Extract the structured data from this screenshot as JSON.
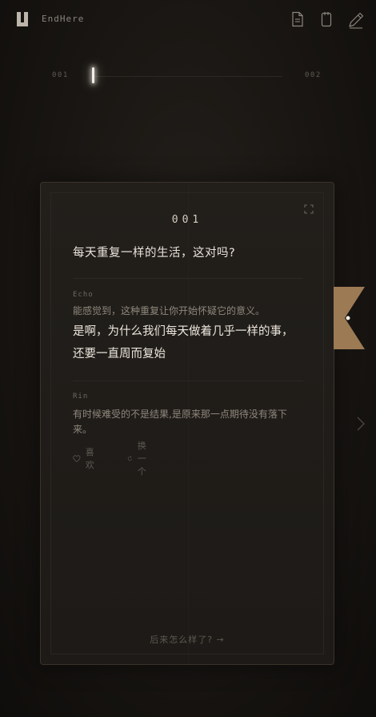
{
  "header": {
    "app_title": "EndHere",
    "icons": [
      "logo-icon",
      "document-icon",
      "phone-icon",
      "pen-icon"
    ]
  },
  "progress": {
    "start_label": "001",
    "end_label": "002",
    "position": 0.0
  },
  "card": {
    "number": "001",
    "question": "每天重复一样的生活，这对吗?",
    "replies": [
      {
        "author": "Echo",
        "text": "能感觉到，这种重复让你开始怀疑它的意义。",
        "highlight_lines": [
          "是啊，为什么我们每天做着几乎一样的事，",
          "还要一直周而复始"
        ]
      },
      {
        "author": "Rin",
        "text_lines": [
          "有时候难受的不是结果,是原来那一点期待没有落下",
          "来。"
        ]
      }
    ],
    "actions": {
      "like_label": "喜欢",
      "refresh_label": "换一个"
    },
    "footer_link": "后来怎么样了? →"
  },
  "colors": {
    "background": "#151210",
    "card_border": "#3a332b",
    "bookmark": "#9c7a54",
    "text_primary": "#ece6dc",
    "text_muted": "#8f877c"
  }
}
